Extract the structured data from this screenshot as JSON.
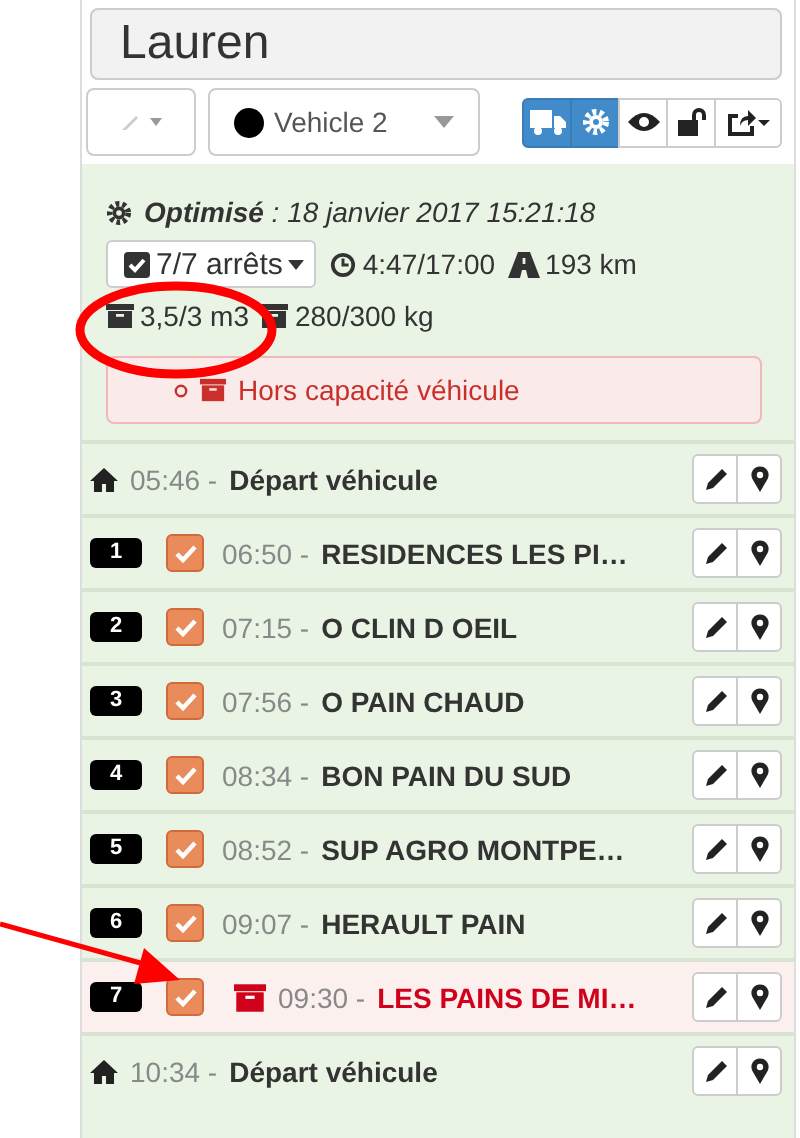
{
  "title": "Lauren",
  "toolbar": {
    "vehicle": {
      "label": "Vehicle 2",
      "color": "#000000"
    },
    "view_buttons": [
      {
        "kind": "truck",
        "selected": true
      },
      {
        "kind": "gear",
        "selected": true
      },
      {
        "kind": "eye",
        "selected": false
      },
      {
        "kind": "unlock",
        "selected": false
      },
      {
        "kind": "export",
        "selected": false
      }
    ]
  },
  "summary": {
    "status": "**Optimisé** : 18 janvier 2017 15:21:18",
    "stops_button": "7/7 arrêts",
    "duration": "4:47/17:00",
    "distance": "193 km",
    "volume": "3,5/3 m3",
    "weight": "280/300 kg",
    "alert": "Hors capacité véhicule"
  },
  "rows": [
    {
      "kind": "depot",
      "time": "05:46 -",
      "name": "Départ véhicule"
    },
    {
      "kind": "stop",
      "number": "1",
      "checked": true,
      "error": false,
      "time": "06:50 -",
      "name": "RESIDENCES LES PI…"
    },
    {
      "kind": "stop",
      "number": "2",
      "checked": true,
      "error": false,
      "time": "07:15 -",
      "name": "O CLIN D OEIL"
    },
    {
      "kind": "stop",
      "number": "3",
      "checked": true,
      "error": false,
      "time": "07:56 -",
      "name": "O PAIN CHAUD"
    },
    {
      "kind": "stop",
      "number": "4",
      "checked": true,
      "error": false,
      "time": "08:34 -",
      "name": "BON PAIN DU SUD"
    },
    {
      "kind": "stop",
      "number": "5",
      "checked": true,
      "error": false,
      "time": "08:52 -",
      "name": "SUP AGRO MONTPE…"
    },
    {
      "kind": "stop",
      "number": "6",
      "checked": true,
      "error": false,
      "time": "09:07 -",
      "name": "HERAULT PAIN"
    },
    {
      "kind": "stop",
      "number": "7",
      "checked": true,
      "error": true,
      "time": "09:30 -",
      "name": "LES PAINS DE MI…"
    },
    {
      "kind": "depot",
      "time": "10:34 -",
      "name": "Départ véhicule"
    }
  ]
}
